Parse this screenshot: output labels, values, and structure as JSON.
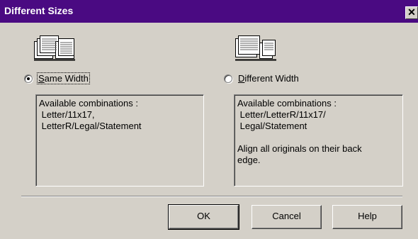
{
  "window": {
    "title": "Different Sizes",
    "close_glyph": "✕",
    "title_bar_color": "#4a0a82"
  },
  "options": [
    {
      "label": "Same Width",
      "mnemonic": "S",
      "selected": true,
      "icon": "document-stack-icon",
      "info_lines": [
        "Available combinations :",
        " Letter/11x17,",
        " LetterR/Legal/Statement"
      ]
    },
    {
      "label": "Different Width",
      "mnemonic": "D",
      "selected": false,
      "icon": "document-stack-icon",
      "info_lines": [
        "Available combinations :",
        " Letter/LetterR/11x17/",
        " Legal/Statement",
        "",
        "Align all originals on their back",
        "edge."
      ]
    }
  ],
  "buttons": {
    "ok": "OK",
    "cancel": "Cancel",
    "help": "Help"
  }
}
